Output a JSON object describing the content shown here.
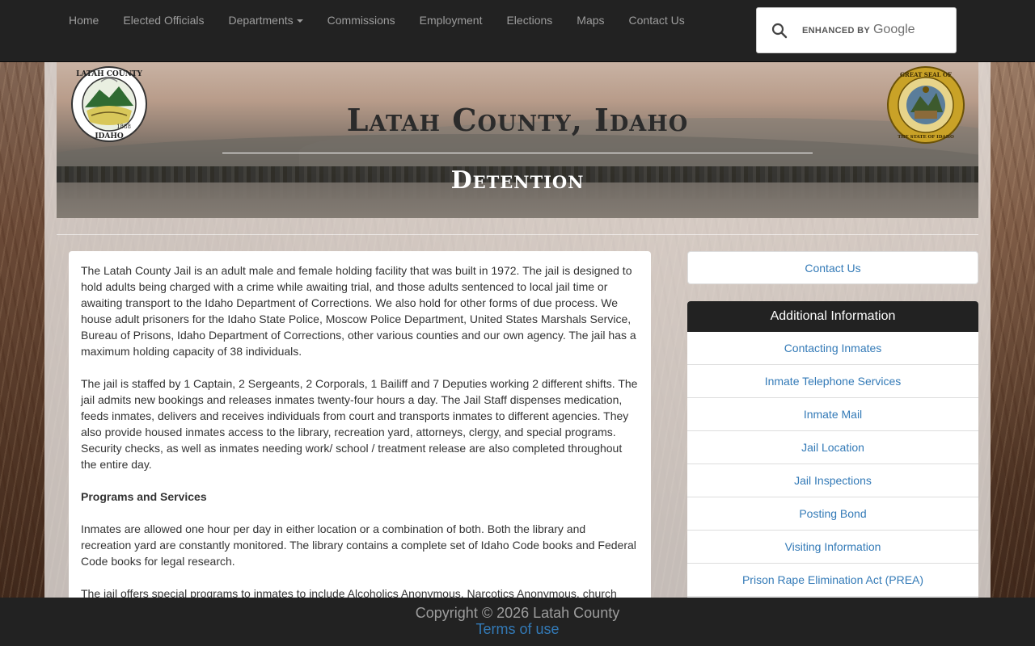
{
  "nav": {
    "items": [
      {
        "label": "Home"
      },
      {
        "label": "Elected Officials"
      },
      {
        "label": "Departments"
      },
      {
        "label": "Commissions"
      },
      {
        "label": "Employment"
      },
      {
        "label": "Elections"
      },
      {
        "label": "Maps"
      },
      {
        "label": "Contact Us"
      }
    ],
    "search": {
      "enhanced_by": "ENHANCED BY",
      "brand": "Google"
    }
  },
  "banner": {
    "title": "Latah County, Idaho",
    "subtitle": "Detention",
    "left_seal_icon": "latah-county-seal-icon",
    "right_seal_icon": "idaho-state-seal-icon",
    "left_seal_text": [
      "LATAH COUNTY",
      "1888",
      "IDAHO"
    ],
    "right_seal_text": [
      "GREAT SEAL OF",
      "THE STATE OF IDAHO"
    ]
  },
  "content": {
    "p1": "The Latah County Jail is an adult male and female holding facility that was built in 1972. The jail is designed to hold adults being charged with a crime while awaiting trial, and those adults sentenced to local jail time or awaiting transport to the Idaho Department of Corrections. We also hold for other forms of due process. We house adult prisoners for the Idaho State Police, Moscow Police Department, United States Marshals Service, Bureau of Prisons, Idaho Department of Corrections, other various counties and our own agency. The jail has a maximum holding capacity of 38 individuals.",
    "p2": "The jail is staffed by 1 Captain, 2 Sergeants, 2 Corporals, 1 Bailiff and 7 Deputies working 2 different shifts. The jail admits new bookings and releases inmates twenty-four hours a day. The Jail Staff dispenses medication, feeds inmates, delivers and receives individuals from court and transports inmates to different agencies. They also provide housed inmates access to the library, recreation yard, attorneys, clergy, and special programs. Security checks, as well as inmates needing work/ school / treatment release are also completed throughout the entire day.",
    "heading": "Programs and Services",
    "p3": "Inmates are allowed one hour per day in either location or a combination of both. Both the library and recreation yard are constantly monitored. The library contains a complete set of Idaho Code books and Federal Code books for legal research.",
    "p4": "The jail offers special programs to inmates to include Alcoholics Anonymous, Narcotics Anonymous, church"
  },
  "sidebar": {
    "contact_label": "Contact Us",
    "info_title": "Additional Information",
    "links": [
      {
        "label": "Contacting Inmates"
      },
      {
        "label": "Inmate Telephone Services"
      },
      {
        "label": "Inmate Mail"
      },
      {
        "label": "Jail Location"
      },
      {
        "label": "Jail Inspections"
      },
      {
        "label": "Posting Bond"
      },
      {
        "label": "Visiting Information"
      },
      {
        "label": "Prison Rape Elimination Act (PREA)"
      }
    ]
  },
  "footer": {
    "copyright": "Copyright © 2026 Latah County",
    "terms": "Terms of use"
  },
  "colors": {
    "navbar": "#222222",
    "nav_text": "#9d9d9d",
    "link": "#337ab7",
    "panel_header": "#222222"
  }
}
